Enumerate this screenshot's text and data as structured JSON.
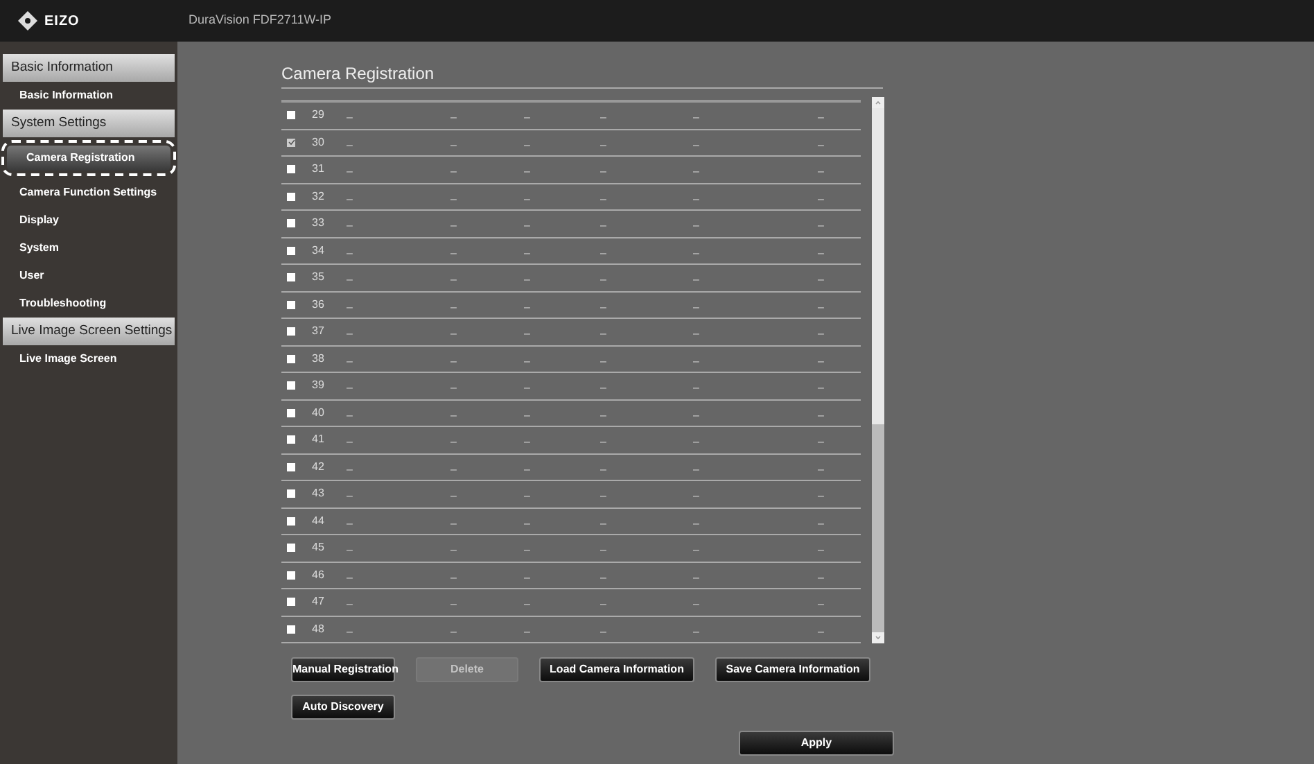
{
  "header": {
    "logo": "EIZO",
    "device_name": "DuraVision FDF2711W-IP"
  },
  "sidebar": {
    "sections": [
      {
        "title": "Basic Information",
        "items": [
          {
            "label": "Basic Information",
            "selected": false
          }
        ]
      },
      {
        "title": "System Settings",
        "items": [
          {
            "label": "Camera Registration",
            "selected": true
          },
          {
            "label": "Camera Function Settings",
            "selected": false
          },
          {
            "label": "Display",
            "selected": false
          },
          {
            "label": "System",
            "selected": false
          },
          {
            "label": "User",
            "selected": false
          },
          {
            "label": "Troubleshooting",
            "selected": false
          }
        ]
      },
      {
        "title": "Live Image Screen Settings",
        "items": [
          {
            "label": "Live Image Screen",
            "selected": false
          }
        ]
      }
    ]
  },
  "page_title": "Camera Registration",
  "table": {
    "rows": [
      {
        "number": "29",
        "checked": false,
        "cells": [
          "–",
          "–",
          "–",
          "–",
          "–",
          "–"
        ]
      },
      {
        "number": "30",
        "checked": true,
        "cells": [
          "–",
          "–",
          "–",
          "–",
          "–",
          "–"
        ]
      },
      {
        "number": "31",
        "checked": false,
        "cells": [
          "–",
          "–",
          "–",
          "–",
          "–",
          "–"
        ]
      },
      {
        "number": "32",
        "checked": false,
        "cells": [
          "–",
          "–",
          "–",
          "–",
          "–",
          "–"
        ]
      },
      {
        "number": "33",
        "checked": false,
        "cells": [
          "–",
          "–",
          "–",
          "–",
          "–",
          "–"
        ]
      },
      {
        "number": "34",
        "checked": false,
        "cells": [
          "–",
          "–",
          "–",
          "–",
          "–",
          "–"
        ]
      },
      {
        "number": "35",
        "checked": false,
        "cells": [
          "–",
          "–",
          "–",
          "–",
          "–",
          "–"
        ]
      },
      {
        "number": "36",
        "checked": false,
        "cells": [
          "–",
          "–",
          "–",
          "–",
          "–",
          "–"
        ]
      },
      {
        "number": "37",
        "checked": false,
        "cells": [
          "–",
          "–",
          "–",
          "–",
          "–",
          "–"
        ]
      },
      {
        "number": "38",
        "checked": false,
        "cells": [
          "–",
          "–",
          "–",
          "–",
          "–",
          "–"
        ]
      },
      {
        "number": "39",
        "checked": false,
        "cells": [
          "–",
          "–",
          "–",
          "–",
          "–",
          "–"
        ]
      },
      {
        "number": "40",
        "checked": false,
        "cells": [
          "–",
          "–",
          "–",
          "–",
          "–",
          "–"
        ]
      },
      {
        "number": "41",
        "checked": false,
        "cells": [
          "–",
          "–",
          "–",
          "–",
          "–",
          "–"
        ]
      },
      {
        "number": "42",
        "checked": false,
        "cells": [
          "–",
          "–",
          "–",
          "–",
          "–",
          "–"
        ]
      },
      {
        "number": "43",
        "checked": false,
        "cells": [
          "–",
          "–",
          "–",
          "–",
          "–",
          "–"
        ]
      },
      {
        "number": "44",
        "checked": false,
        "cells": [
          "–",
          "–",
          "–",
          "–",
          "–",
          "–"
        ]
      },
      {
        "number": "45",
        "checked": false,
        "cells": [
          "–",
          "–",
          "–",
          "–",
          "–",
          "–"
        ]
      },
      {
        "number": "46",
        "checked": false,
        "cells": [
          "–",
          "–",
          "–",
          "–",
          "–",
          "–"
        ]
      },
      {
        "number": "47",
        "checked": false,
        "cells": [
          "–",
          "–",
          "–",
          "–",
          "–",
          "–"
        ]
      },
      {
        "number": "48",
        "checked": false,
        "cells": [
          "–",
          "–",
          "–",
          "–",
          "–",
          "–"
        ]
      }
    ]
  },
  "buttons": [
    [
      {
        "label": "Manual Registration",
        "disabled": false
      },
      {
        "label": "Delete",
        "disabled": true
      },
      {
        "label": "Load Camera Information",
        "disabled": false
      },
      {
        "label": "Save Camera Information",
        "disabled": false
      }
    ],
    [
      {
        "label": "Auto Discovery",
        "disabled": false
      }
    ]
  ],
  "apply_button": {
    "label": "Apply"
  }
}
